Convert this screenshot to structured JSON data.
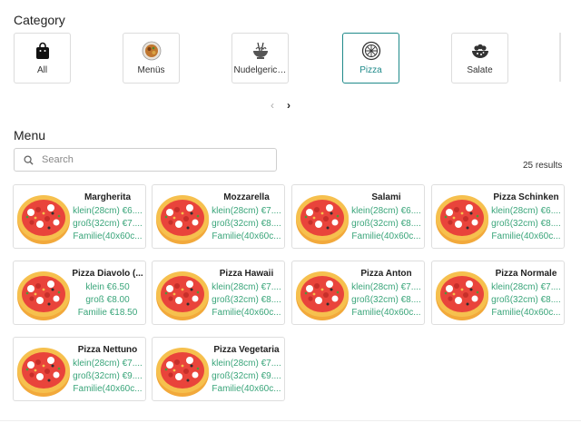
{
  "category": {
    "title": "Category",
    "items": [
      {
        "label": "All",
        "icon": "shopping-bag-icon",
        "active": false
      },
      {
        "label": "Menüs",
        "icon": "food-plate-icon",
        "active": false
      },
      {
        "label": "Nudelgerichte",
        "icon": "noodle-bowl-icon",
        "active": false
      },
      {
        "label": "Pizza",
        "icon": "pizza-icon",
        "active": true
      },
      {
        "label": "Salate",
        "icon": "salad-bowl-icon",
        "active": false
      }
    ],
    "accent": "#1f8a8a",
    "prev_icon": "chevron-left-icon",
    "next_icon": "chevron-right-icon"
  },
  "menu": {
    "title": "Menu",
    "search_placeholder": "Search",
    "search_icon": "search-icon",
    "results": "25 results",
    "price_color": "#3aa57a",
    "items": [
      {
        "name": "Margherita",
        "prices": [
          "klein(28cm) €6....",
          "groß(32cm) €7....",
          "Familie(40x60c..."
        ]
      },
      {
        "name": "Mozzarella",
        "prices": [
          "klein(28cm) €7....",
          "groß(32cm) €8....",
          "Familie(40x60c..."
        ]
      },
      {
        "name": "Salami",
        "prices": [
          "klein(28cm) €6....",
          "groß(32cm) €8....",
          "Familie(40x60c..."
        ]
      },
      {
        "name": "Pizza Schinken",
        "prices": [
          "klein(28cm) €6....",
          "groß(32cm) €8....",
          "Familie(40x60c..."
        ]
      },
      {
        "name": "Pizza Diavolo (...",
        "prices": [
          "klein €6.50",
          "groß €8.00",
          "Familie €18.50"
        ]
      },
      {
        "name": "Pizza Hawaii",
        "prices": [
          "klein(28cm) €7....",
          "groß(32cm) €8....",
          "Familie(40x60c..."
        ]
      },
      {
        "name": "Pizza Anton",
        "prices": [
          "klein(28cm) €7....",
          "groß(32cm) €8....",
          "Familie(40x60c..."
        ]
      },
      {
        "name": "Pizza Normale",
        "prices": [
          "klein(28cm) €7....",
          "groß(32cm) €8....",
          "Familie(40x60c..."
        ]
      },
      {
        "name": "Pizza Nettuno",
        "prices": [
          "klein(28cm) €7....",
          "groß(32cm) €9....",
          "Familie(40x60c..."
        ]
      },
      {
        "name": "Pizza Vegetaria",
        "prices": [
          "klein(28cm) €7....",
          "groß(32cm) €9....",
          "Familie(40x60c..."
        ]
      }
    ]
  }
}
